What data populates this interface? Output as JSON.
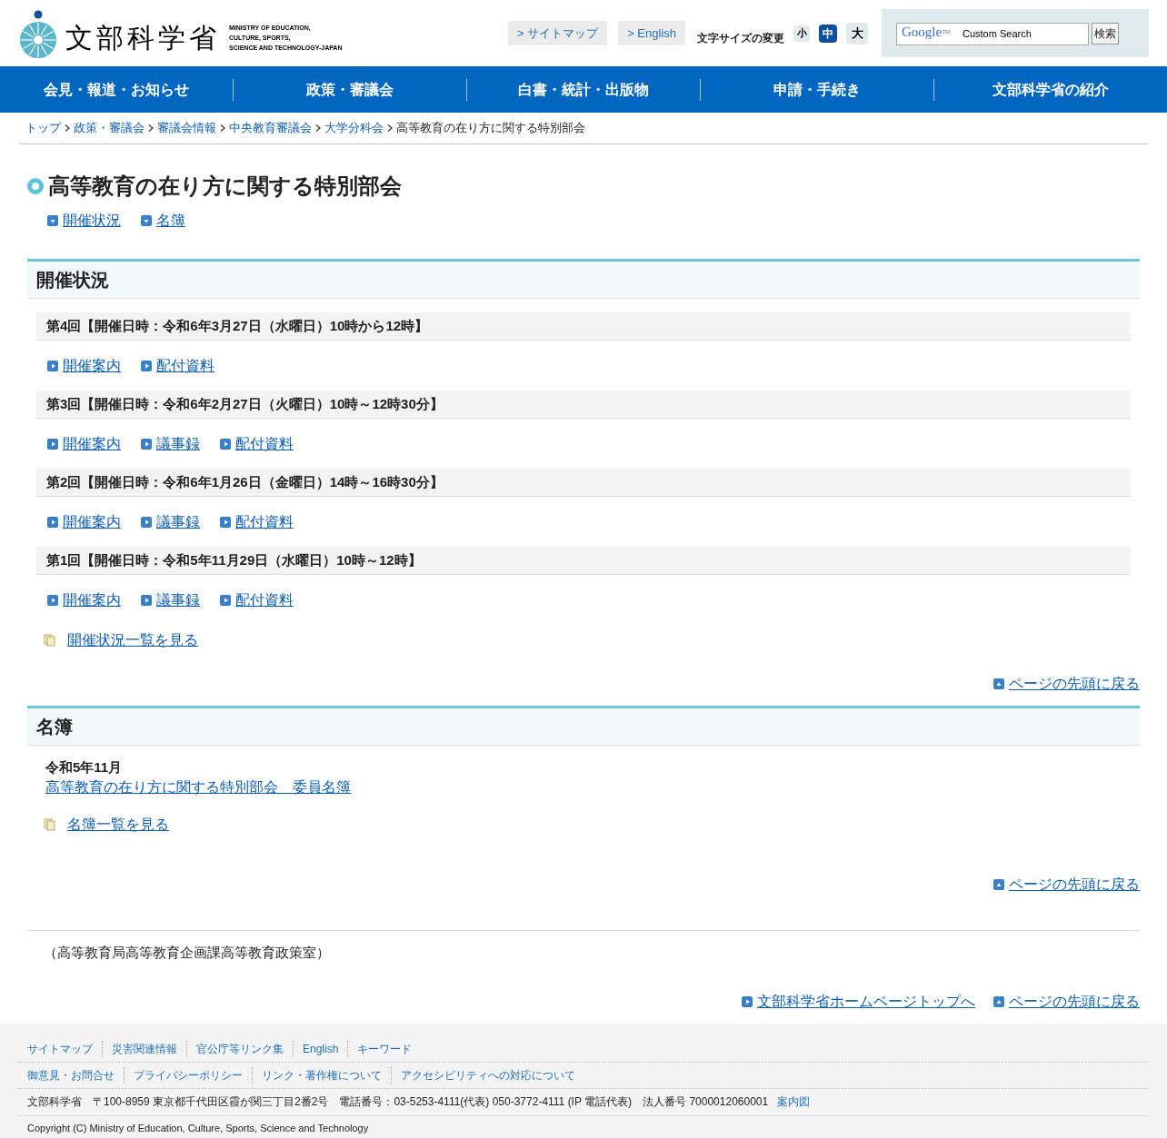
{
  "header": {
    "logo": {
      "title": "文部科学省",
      "subtitle": [
        "MINISTRY OF EDUCATION,",
        "CULTURE, SPORTS,",
        "SCIENCE AND TECHNOLOGY-JAPAN"
      ]
    },
    "links": [
      "> サイトマップ",
      "> English"
    ],
    "font_size": {
      "label": "文字サイズの変更",
      "options": [
        {
          "label": "小",
          "selected": false
        },
        {
          "label": "中",
          "selected": true
        },
        {
          "label": "大",
          "selected": false
        }
      ]
    },
    "search": {
      "brand": "Google",
      "trademark": "TM",
      "placeholder": "Custom Search",
      "button": "検索"
    }
  },
  "nav": [
    "会見・報道・お知らせ",
    "政策・審議会",
    "白書・統計・出版物",
    "申請・手続き",
    "文部科学省の紹介"
  ],
  "breadcrumb": [
    {
      "label": "トップ",
      "link": true
    },
    {
      "label": "政策・審議会",
      "link": true
    },
    {
      "label": "審議会情報",
      "link": true
    },
    {
      "label": "中央教育審議会",
      "link": true
    },
    {
      "label": "大学分科会",
      "link": true
    },
    {
      "label": "高等教育の在り方に関する特別部会",
      "link": false
    }
  ],
  "page": {
    "title": "高等教育の在り方に関する特別部会",
    "anchors": [
      "開催状況",
      "名簿"
    ]
  },
  "meetings_section": {
    "heading": "開催状況",
    "meetings": [
      {
        "title": "第4回【開催日時：令和6年3月27日（水曜日）10時から12時】",
        "links": [
          "開催案内",
          "配付資料"
        ]
      },
      {
        "title": "第3回【開催日時：令和6年2月27日（火曜日）10時～12時30分】",
        "links": [
          "開催案内",
          "議事録",
          "配付資料"
        ]
      },
      {
        "title": "第2回【開催日時：令和6年1月26日（金曜日）14時～16時30分】",
        "links": [
          "開催案内",
          "議事録",
          "配付資料"
        ]
      },
      {
        "title": "第1回【開催日時：令和5年11月29日（水曜日）10時～12時】",
        "links": [
          "開催案内",
          "議事録",
          "配付資料"
        ]
      }
    ],
    "more_link": "開催状況一覧を見る",
    "back_to_top": "ページの先頭に戻る"
  },
  "roster_section": {
    "heading": "名簿",
    "date": "令和5年11月",
    "document": "高等教育の在り方に関する特別部会　委員名簿",
    "more_link": "名簿一覧を見る",
    "back_to_top": "ページの先頭に戻る"
  },
  "office": "（高等教育局高等教育企画課高等教育政策室）",
  "bottom_links": [
    "文部科学省ホームページトップへ",
    "ページの先頭に戻る"
  ],
  "footer": {
    "links_row_1": [
      "サイトマップ",
      "災害関連情報",
      "官公庁等リンク集",
      "English",
      "キーワード"
    ],
    "links_row_2": [
      "御意見・お問合せ",
      "プライバシーポリシー",
      "リンク・著作権について",
      "アクセシビリティへの対応について"
    ],
    "address": "文部科学省　〒100-8959 東京都千代田区霞が関三丁目2番2号　電話番号：03-5253-4111(代表) 050-3772-4111 (IP 電話代表)　法人番号 7000012060001",
    "map_link": "案内図",
    "copyright": "Copyright (C) Ministry of Education, Culture, Sports, Science and Technology"
  }
}
